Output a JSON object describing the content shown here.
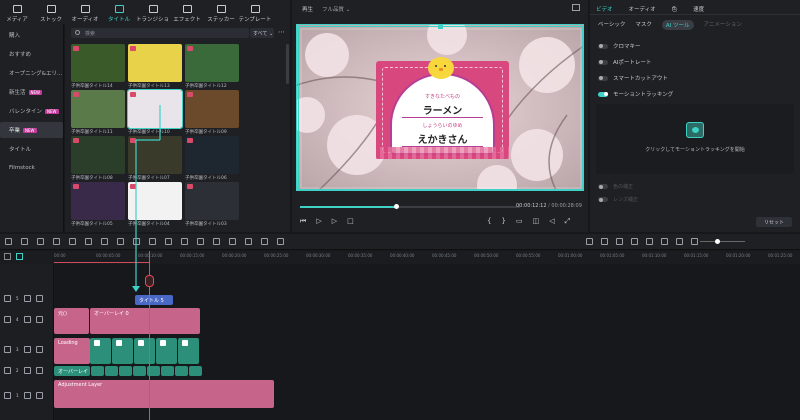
{
  "top_tabs": [
    {
      "label": "メディア",
      "icon": "media-icon"
    },
    {
      "label": "ストック",
      "icon": "stock-icon"
    },
    {
      "label": "オーディオ",
      "icon": "music-note-icon"
    },
    {
      "label": "タイトル",
      "icon": "title-t-icon"
    },
    {
      "label": "トランジション",
      "icon": "transition-icon"
    },
    {
      "label": "エフェクト",
      "icon": "effect-sparkle-icon"
    },
    {
      "label": "ステッカー",
      "icon": "sticker-icon"
    },
    {
      "label": "テンプレート",
      "icon": "template-icon"
    }
  ],
  "sidebar": {
    "items": [
      {
        "label": "購入"
      },
      {
        "label": "おすすめ"
      },
      {
        "label": "オープニング&エリ..."
      },
      {
        "label": "新生活",
        "tag": "NEW"
      },
      {
        "label": "バレンタイン",
        "tag": "NEW"
      },
      {
        "label": "卒業",
        "tag": "NEW"
      },
      {
        "label": "タイトル"
      },
      {
        "label": "Filmstock"
      }
    ]
  },
  "search": {
    "placeholder": "検索",
    "filter": "すべて"
  },
  "thumbnails": [
    "子供卒園タイトル14",
    "子供卒園タイトル13",
    "子供卒園タイトル12",
    "子供卒園タイトル11",
    "子供卒園タイトル10",
    "子供卒園タイトル09",
    "子供卒園タイトル08",
    "子供卒園タイトル07",
    "子供卒園タイトル06",
    "子供卒園タイトル05",
    "子供卒園タイトル04",
    "子供卒園タイトル03"
  ],
  "player": {
    "mode": "再生",
    "quality": "フル品質",
    "card_small_top": "すきなたべもの",
    "card_big_top": "ラーメン",
    "card_small_bottom": "しょうらいのゆめ",
    "card_big_bottom": "えかきさん",
    "time_current": "00:00:12:12",
    "time_total": "00:00:28:09"
  },
  "right_panel": {
    "tabs": [
      "ビデオ",
      "オーディオ",
      "色",
      "速度"
    ],
    "subtabs": [
      "ベーシック",
      "マスク",
      "AI ツール",
      "アニメーション"
    ],
    "rows": [
      "クロマキー",
      "AIポートレート",
      "スマートカットアウト",
      "モーショントラッキング"
    ],
    "motion_hint": "クリックしてモーショントラッキングを開始",
    "disabled_rows": [
      "色の補正",
      "レンズ補正"
    ],
    "reset": "リセット"
  },
  "ruler": [
    "00:00",
    "00:00:05:00",
    "00:00:10:00",
    "00:00:15:00",
    "00:00:20:00",
    "00:00:25:00",
    "00:00:30:00",
    "00:00:35:00",
    "00:00:40:00",
    "00:00:45:00",
    "00:00:50:00",
    "00:00:55:00",
    "00:01:00:00",
    "00:01:05:00",
    "00:01:10:00",
    "00:01:15:00",
    "00:01:20:00",
    "00:01:25:00"
  ],
  "tracks": {
    "numbers": [
      "5",
      "4",
      "3",
      "2",
      "1"
    ]
  },
  "clips": {
    "title_clip": "タイトル 5",
    "overlay_a": "元()",
    "overlay_b": "オーバーレイ 0",
    "loading": "Loading",
    "overlay_c": "オーバーレイ",
    "adjustment": "Adjustment Layer"
  },
  "colors": {
    "accent": "#3fd1c5",
    "pink_clip": "#c6648a",
    "teal_clip": "#2c8f7a",
    "blue_clip": "#4a68c6"
  }
}
